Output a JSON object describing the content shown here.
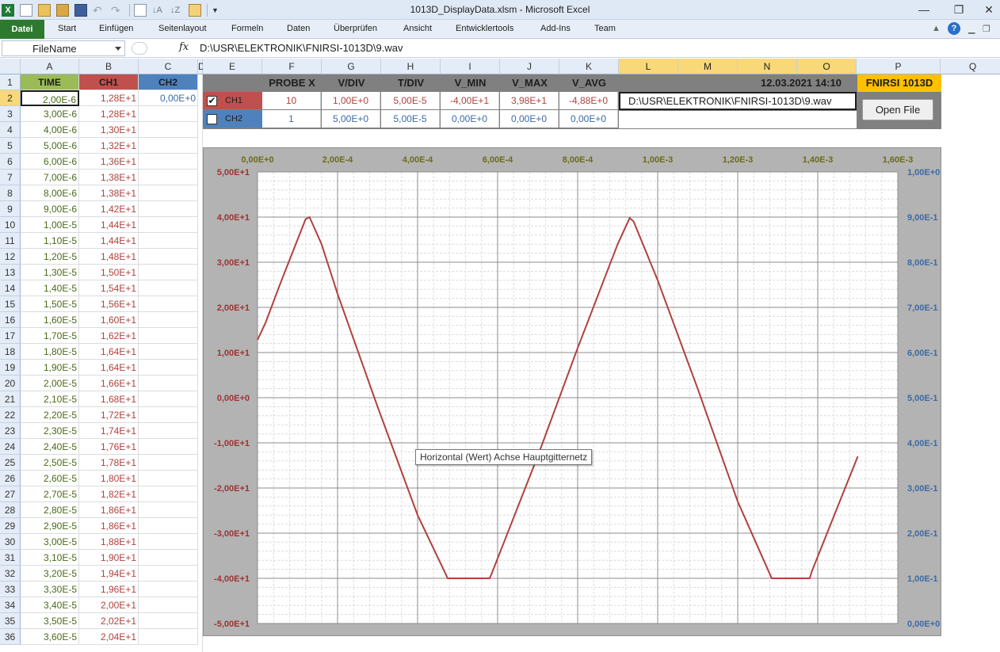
{
  "window": {
    "title": "1013D_DisplayData.xlsm  -  Microsoft Excel",
    "minimize": "—",
    "restore": "❐",
    "close": "✕"
  },
  "ribbon": {
    "file_tab": "Datei",
    "tabs": [
      "Start",
      "Einfügen",
      "Seitenlayout",
      "Formeln",
      "Daten",
      "Überprüfen",
      "Ansicht",
      "Entwicklertools",
      "Add-Ins",
      "Team"
    ]
  },
  "formula_bar": {
    "name_box": "FileName",
    "fx": "fx",
    "formula": "D:\\USR\\ELEKTRONIK\\FNIRSI-1013D\\9.wav"
  },
  "columns": [
    "A",
    "B",
    "C",
    "D",
    "E",
    "F",
    "G",
    "H",
    "I",
    "J",
    "K",
    "L",
    "M",
    "N",
    "O",
    "P",
    "Q"
  ],
  "table": {
    "headers": [
      "TIME",
      "CH1",
      "CH2"
    ],
    "ch2_first": "0,00E+0",
    "time": [
      "2,00E-6",
      "3,00E-6",
      "4,00E-6",
      "5,00E-6",
      "6,00E-6",
      "7,00E-6",
      "8,00E-6",
      "9,00E-6",
      "1,00E-5",
      "1,10E-5",
      "1,20E-5",
      "1,30E-5",
      "1,40E-5",
      "1,50E-5",
      "1,60E-5",
      "1,70E-5",
      "1,80E-5",
      "1,90E-5",
      "2,00E-5",
      "2,10E-5",
      "2,20E-5",
      "2,30E-5",
      "2,40E-5",
      "2,50E-5",
      "2,60E-5",
      "2,70E-5",
      "2,80E-5",
      "2,90E-5",
      "3,00E-5",
      "3,10E-5",
      "3,20E-5",
      "3,30E-5",
      "3,40E-5",
      "3,50E-5",
      "3,60E-5"
    ],
    "ch1": [
      "1,28E+1",
      "1,28E+1",
      "1,30E+1",
      "1,32E+1",
      "1,36E+1",
      "1,38E+1",
      "1,38E+1",
      "1,42E+1",
      "1,44E+1",
      "1,44E+1",
      "1,48E+1",
      "1,50E+1",
      "1,54E+1",
      "1,56E+1",
      "1,60E+1",
      "1,62E+1",
      "1,64E+1",
      "1,64E+1",
      "1,66E+1",
      "1,68E+1",
      "1,72E+1",
      "1,74E+1",
      "1,76E+1",
      "1,78E+1",
      "1,80E+1",
      "1,82E+1",
      "1,86E+1",
      "1,86E+1",
      "1,88E+1",
      "1,90E+1",
      "1,94E+1",
      "1,96E+1",
      "2,00E+1",
      "2,02E+1",
      "2,04E+1"
    ]
  },
  "panel": {
    "headers": [
      "PROBE X",
      "V/DIV",
      "T/DIV",
      "V_MIN",
      "V_MAX",
      "V_AVG"
    ],
    "datetime": "12.03.2021 14:10",
    "device": "FNIRSI 1013D",
    "ch1": {
      "checked": "✔",
      "label": "CH1",
      "values": [
        "10",
        "1,00E+0",
        "5,00E-5",
        "-4,00E+1",
        "3,98E+1",
        "-4,88E+0"
      ]
    },
    "ch2": {
      "checked": "",
      "label": "CH2",
      "values": [
        "1",
        "5,00E+0",
        "5,00E-5",
        "0,00E+0",
        "0,00E+0",
        "0,00E+0"
      ]
    },
    "file_path": "D:\\USR\\ELEKTRONIK\\FNIRSI-1013D\\9.wav",
    "open_button": "Open File"
  },
  "tooltip": "Horizontal (Wert) Achse Hauptgitternetz",
  "colors": {
    "ch1": "#b0413e",
    "ch2": "#3b6aa6",
    "green_header": "#9bbb59",
    "ch1_header": "#c0504d",
    "ch2_header": "#4f81bd",
    "device_bg": "#ffc000"
  },
  "chart_data": {
    "type": "line",
    "title": "",
    "xlabel": "",
    "ylabel": "",
    "x_ticks": [
      "0,00E+0",
      "2,00E-4",
      "4,00E-4",
      "6,00E-4",
      "8,00E-4",
      "1,00E-3",
      "1,20E-3",
      "1,40E-3",
      "1,60E-3"
    ],
    "y_left_ticks": [
      "5,00E+1",
      "4,00E+1",
      "3,00E+1",
      "2,00E+1",
      "1,00E+1",
      "0,00E+0",
      "-1,00E+1",
      "-2,00E+1",
      "-3,00E+1",
      "-4,00E+1",
      "-5,00E+1"
    ],
    "y_right_ticks": [
      "1,00E+0",
      "9,00E-1",
      "8,00E-1",
      "7,00E-1",
      "6,00E-1",
      "5,00E-1",
      "4,00E-1",
      "3,00E-1",
      "2,00E-1",
      "1,00E-1",
      "0,00E+0"
    ],
    "xlim": [
      0,
      0.0016
    ],
    "ylim_left": [
      -50,
      50
    ],
    "ylim_right": [
      0,
      1
    ],
    "grid": true,
    "series": [
      {
        "name": "CH1",
        "axis": "left",
        "x": [
          0,
          2e-05,
          6e-05,
          0.0001,
          0.00012,
          0.00013,
          0.00016,
          0.0002,
          0.0003,
          0.0004,
          0.00047,
          0.000475,
          0.00058,
          0.000585,
          0.0007,
          0.0008,
          0.0009,
          0.00093,
          0.00094,
          0.001,
          0.0011,
          0.0012,
          0.00128,
          0.001285,
          0.00138,
          0.001385,
          0.0015
        ],
        "y": [
          12.8,
          16.6,
          26,
          35,
          39.5,
          40,
          34,
          23,
          -2,
          -26,
          -39,
          -40,
          -40,
          -39,
          -13,
          11,
          34,
          39.8,
          39,
          26,
          2,
          -23,
          -39,
          -40,
          -40,
          -38.5,
          -13
        ]
      }
    ]
  }
}
